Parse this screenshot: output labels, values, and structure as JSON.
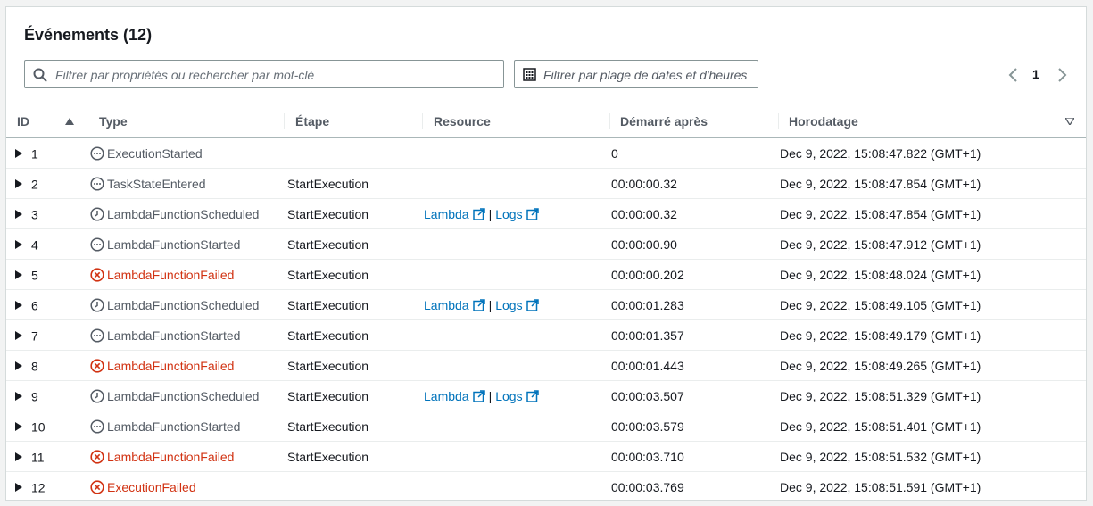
{
  "title": "Événements (12)",
  "search": {
    "placeholder": "Filtrer par propriétés ou rechercher par mot-clé",
    "value": ""
  },
  "date_filter": {
    "label": "Filtrer par plage de dates et d'heures"
  },
  "pagination": {
    "current_page": "1"
  },
  "columns": {
    "id": "ID",
    "type": "Type",
    "step": "Étape",
    "resource": "Resource",
    "started_after": "Démarré après",
    "timestamp": "Horodatage"
  },
  "resource_links": {
    "lambda": "Lambda",
    "separator": "|",
    "logs": "Logs"
  },
  "colors": {
    "error": "#d13212",
    "link": "#0073bb",
    "muted": "#545b64"
  },
  "rows": [
    {
      "id": "1",
      "type": "ExecutionStarted",
      "status": "info",
      "step": "",
      "resource": false,
      "started_after": "0",
      "timestamp": "Dec 9, 2022, 15:08:47.822 (GMT+1)"
    },
    {
      "id": "2",
      "type": "TaskStateEntered",
      "status": "info",
      "step": "StartExecution",
      "resource": false,
      "started_after": "00:00:00.32",
      "timestamp": "Dec 9, 2022, 15:08:47.854 (GMT+1)"
    },
    {
      "id": "3",
      "type": "LambdaFunctionScheduled",
      "status": "scheduled",
      "step": "StartExecution",
      "resource": true,
      "started_after": "00:00:00.32",
      "timestamp": "Dec 9, 2022, 15:08:47.854 (GMT+1)"
    },
    {
      "id": "4",
      "type": "LambdaFunctionStarted",
      "status": "info",
      "step": "StartExecution",
      "resource": false,
      "started_after": "00:00:00.90",
      "timestamp": "Dec 9, 2022, 15:08:47.912 (GMT+1)"
    },
    {
      "id": "5",
      "type": "LambdaFunctionFailed",
      "status": "error",
      "step": "StartExecution",
      "resource": false,
      "started_after": "00:00:00.202",
      "timestamp": "Dec 9, 2022, 15:08:48.024 (GMT+1)"
    },
    {
      "id": "6",
      "type": "LambdaFunctionScheduled",
      "status": "scheduled",
      "step": "StartExecution",
      "resource": true,
      "started_after": "00:00:01.283",
      "timestamp": "Dec 9, 2022, 15:08:49.105 (GMT+1)"
    },
    {
      "id": "7",
      "type": "LambdaFunctionStarted",
      "status": "info",
      "step": "StartExecution",
      "resource": false,
      "started_after": "00:00:01.357",
      "timestamp": "Dec 9, 2022, 15:08:49.179 (GMT+1)"
    },
    {
      "id": "8",
      "type": "LambdaFunctionFailed",
      "status": "error",
      "step": "StartExecution",
      "resource": false,
      "started_after": "00:00:01.443",
      "timestamp": "Dec 9, 2022, 15:08:49.265 (GMT+1)"
    },
    {
      "id": "9",
      "type": "LambdaFunctionScheduled",
      "status": "scheduled",
      "step": "StartExecution",
      "resource": true,
      "started_after": "00:00:03.507",
      "timestamp": "Dec 9, 2022, 15:08:51.329 (GMT+1)"
    },
    {
      "id": "10",
      "type": "LambdaFunctionStarted",
      "status": "info",
      "step": "StartExecution",
      "resource": false,
      "started_after": "00:00:03.579",
      "timestamp": "Dec 9, 2022, 15:08:51.401 (GMT+1)"
    },
    {
      "id": "11",
      "type": "LambdaFunctionFailed",
      "status": "error",
      "step": "StartExecution",
      "resource": false,
      "started_after": "00:00:03.710",
      "timestamp": "Dec 9, 2022, 15:08:51.532 (GMT+1)"
    },
    {
      "id": "12",
      "type": "ExecutionFailed",
      "status": "error",
      "step": "",
      "resource": false,
      "started_after": "00:00:03.769",
      "timestamp": "Dec 9, 2022, 15:08:51.591 (GMT+1)"
    }
  ]
}
